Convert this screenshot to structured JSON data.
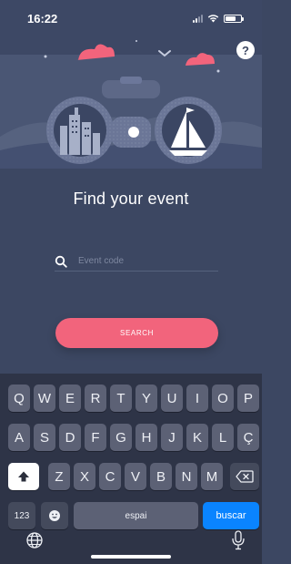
{
  "status_bar": {
    "time": "16:22"
  },
  "help_button_label": "?",
  "title": "Find your event",
  "search": {
    "placeholder": "Event code",
    "value": ""
  },
  "search_button_label": "SEARCH",
  "keyboard": {
    "row1": [
      "Q",
      "W",
      "E",
      "R",
      "T",
      "Y",
      "U",
      "I",
      "O",
      "P"
    ],
    "row2": [
      "A",
      "S",
      "D",
      "F",
      "G",
      "H",
      "J",
      "K",
      "L",
      "Ç"
    ],
    "row3": [
      "Z",
      "X",
      "C",
      "V",
      "B",
      "N",
      "M"
    ],
    "numbers_key": "123",
    "space_key": "espai",
    "return_key": "buscar"
  },
  "colors": {
    "background": "#3c4762",
    "hero": "#4a5674",
    "accent": "#f2647c",
    "keyboard_bg": "#2e3447",
    "return_key": "#0a84ff"
  },
  "icons": {
    "search": "magnifier-icon",
    "shift": "shift-icon",
    "backspace": "backspace-icon",
    "emoji": "emoji-icon",
    "globe": "globe-icon",
    "microphone": "microphone-icon",
    "help": "help-icon"
  }
}
